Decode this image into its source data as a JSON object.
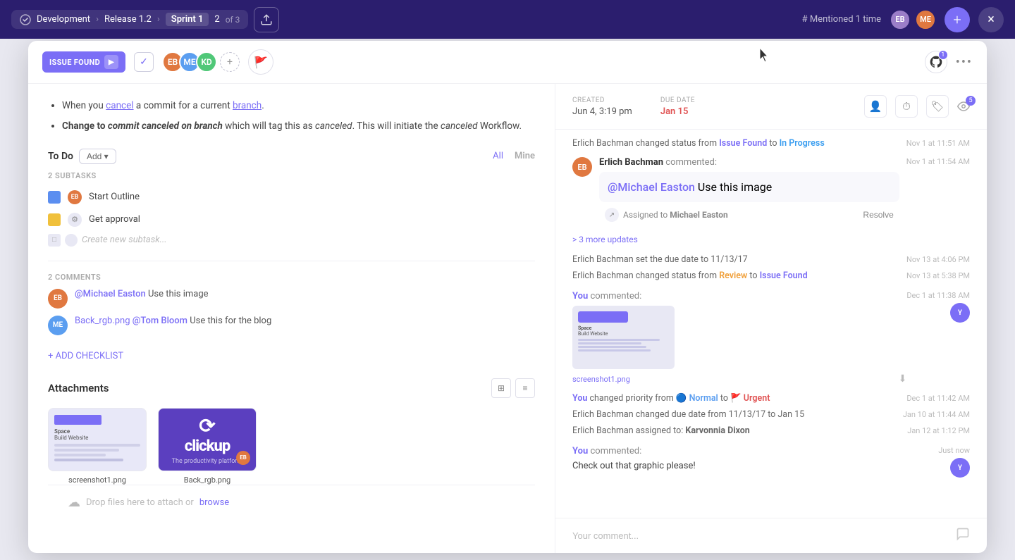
{
  "nav": {
    "workspace": "Development",
    "release": "Release 1.2",
    "sprint": "Sprint 1",
    "sprint_num": "2",
    "sprint_of": "of 3",
    "mentioned": "# Mentioned 1 time",
    "plus_label": "+",
    "close_label": "×"
  },
  "modal": {
    "status": "ISSUE FOUND",
    "created_label": "CREATED",
    "created_value": "Jun 4, 3:19 pm",
    "due_label": "DUE DATE",
    "due_value": "Jan 15",
    "github_badge": "1",
    "watch_badge": "5"
  },
  "content": {
    "bullet1_prefix": "When you ",
    "bullet1_link": "cancel",
    "bullet1_mid": " a commit for a current ",
    "bullet1_link2": "branch",
    "bullet1_end": ".",
    "bullet2_bold": "Change to commit canceled on branch",
    "bullet2_rest": " which will tag this as canceled. This will initiate the canceled Workflow.",
    "todo_label": "To Do",
    "add_label": "Add ▾",
    "filter_all": "All",
    "filter_mine": "Mine",
    "subtasks_label": "2 SUBTASKS",
    "subtask1": "Start Outline",
    "subtask2": "Get approval",
    "create_subtask_placeholder": "Create new subtask...",
    "comments_label": "2 COMMENTS",
    "comment1_author": "@Michael Easton",
    "comment1_text": " Use this image",
    "comment2_link": "Back_rgb.png",
    "comment2_author": " @Tom Bloom",
    "comment2_text": "Use this for the blog",
    "add_checklist": "+ ADD CHECKLIST"
  },
  "attachments": {
    "title": "Attachments",
    "file1": "screenshot1.png",
    "file2": "Back_rgb.png",
    "drop_text": "Drop files here to attach or ",
    "drop_link": "browse"
  },
  "activity": {
    "items": [
      {
        "type": "system",
        "text_prefix": "Erlich Bachman changed status from ",
        "status_from": "Issue Found",
        "status_from_class": "issue-found",
        "text_mid": " to ",
        "status_to": "In Progress",
        "status_to_class": "in-progress",
        "time": "Nov 1 at 11:51 AM"
      },
      {
        "type": "comment",
        "author": "Erlich Bachman",
        "author_label": " commented:",
        "comment_at": "@Michael Easton",
        "comment_text": " Use this image",
        "time": "Nov 1 at 11:54 AM",
        "avatar_color": "#e07840"
      },
      {
        "type": "assigned",
        "text": "Assigned to ",
        "name": "Michael Easton",
        "resolve_label": "Resolve"
      },
      {
        "type": "more",
        "text": "> 3 more updates"
      },
      {
        "type": "system",
        "text_prefix": "Erlich Bachman set the due date to 11/13/17",
        "time": "Nov 13 at 4:06 PM"
      },
      {
        "type": "system",
        "text_prefix": "Erlich Bachman changed status from ",
        "status_from": "Review",
        "status_from_class": "review",
        "text_mid": " to ",
        "status_to": "Issue Found",
        "status_to_class": "issue-found",
        "time": "Nov 13 at 5:38 PM"
      },
      {
        "type": "you-comment",
        "author": "You",
        "author_label": " commented:",
        "time": "Dec 1 at 11:38 AM",
        "has_screenshot": true,
        "screenshot_name": "screenshot1.png"
      },
      {
        "type": "system",
        "text_prefix": "You",
        "text_you": true,
        "text_mid": " changed priority from ",
        "priority_from": "Normal",
        "priority_from_class": "normal",
        "text_from_mid": " to ",
        "priority_to": "Urgent",
        "priority_to_class": "urgent",
        "time": "Dec 1 at 11:42 AM"
      },
      {
        "type": "system",
        "text_prefix": "Erlich Bachman changed due date from 11/13/17 to Jan 15",
        "time": "Jan 10 at 11:44 AM"
      },
      {
        "type": "system",
        "text_prefix": "Erlich Bachman assigned to: ",
        "name": "Karvonnia Dixon",
        "time": "Jan 12 at 1:12 PM"
      },
      {
        "type": "you-comment2",
        "author": "You",
        "author_label": " commented:",
        "comment_text": "Check out that graphic please!",
        "time": "Just now"
      }
    ]
  },
  "comment_placeholder": "Your comment...",
  "avatars": [
    {
      "color": "#e07840",
      "initials": "EB"
    },
    {
      "color": "#5b9ef0",
      "initials": "ME"
    },
    {
      "color": "#50c878",
      "initials": "KD"
    }
  ]
}
